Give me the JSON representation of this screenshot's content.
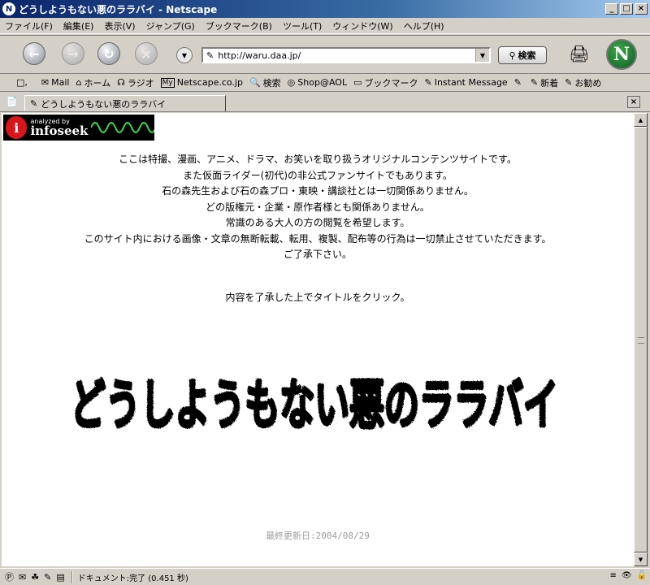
{
  "window": {
    "title": "どうしようもない悪のララバイ - Netscape",
    "app_icon": "N",
    "minimize": "_",
    "maximize": "□",
    "close": "×"
  },
  "menu": [
    "ファイル(F)",
    "編集(E)",
    "表示(V)",
    "ジャンプ(G)",
    "ブックマーク(B)",
    "ツール(T)",
    "ウィンドウ(W)",
    "ヘルプ(H)"
  ],
  "nav": {
    "url": "http://waru.daa.jp/",
    "search_label": "検索"
  },
  "bookmarks": [
    {
      "icon": "✉",
      "label": "Mail"
    },
    {
      "icon": "⌂",
      "label": "ホーム"
    },
    {
      "icon": "☊",
      "label": "ラジオ"
    },
    {
      "icon": "My",
      "label": "Netscape.co.jp"
    },
    {
      "icon": "🔍",
      "label": "検索"
    },
    {
      "icon": "◎",
      "label": "Shop@AOL"
    },
    {
      "icon": "▭",
      "label": "ブックマーク"
    },
    {
      "icon": "✎",
      "label": "Instant Message"
    },
    {
      "icon": "✎",
      "label": ""
    },
    {
      "icon": "✎",
      "label": "新着"
    },
    {
      "icon": "✎",
      "label": "お勧め"
    }
  ],
  "tab": {
    "label": "どうしようもない悪のララバイ"
  },
  "badge": {
    "line1": "analyzed by",
    "line2": "infoseek",
    "letter": "i"
  },
  "intro_lines": [
    "ここは特撮、漫画、アニメ、ドラマ、お笑いを取り扱うオリジナルコンテンツサイトです。",
    "また仮面ライダー(初代)の非公式ファンサイトでもあります。",
    "石の森先生および石の森プロ・東映・講談社とは一切関係ありません。",
    "どの版権元・企業・原作者様とも関係ありません。",
    "常識のある大人の方の閲覧を希望します。",
    "このサイト内における画像・文章の無断転載、転用、複製、配布等の行為は一切禁止させていただきます。",
    "ご了承下さい。"
  ],
  "prompt": "内容を了承した上でタイトルをクリック。",
  "site_title": "どうしようもない悪のララバイ",
  "updated": "最終更新日:2004/08/29",
  "status": {
    "text": "ドキュメント:完了 (0.451 秒)"
  }
}
